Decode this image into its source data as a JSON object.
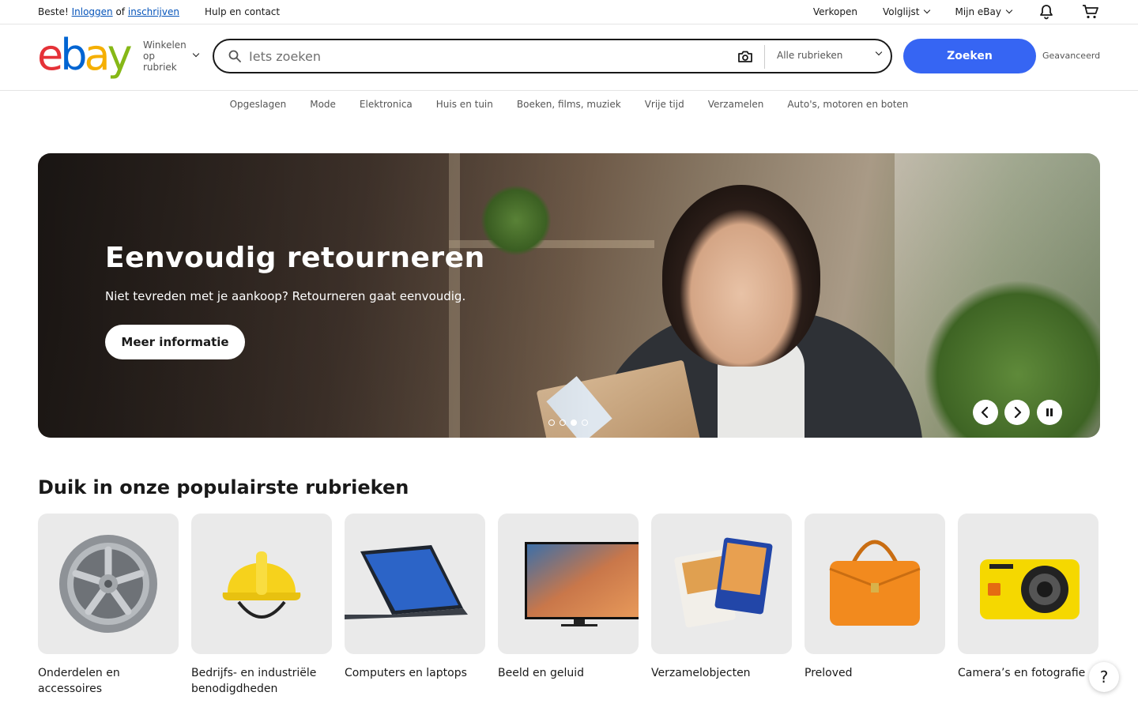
{
  "topbar": {
    "greeting": "Beste!",
    "login": "Inloggen",
    "or": "of",
    "register": "inschrijven",
    "help": "Hulp en contact",
    "sell": "Verkopen",
    "watchlist": "Volglijst",
    "my_ebay": "Mijn eBay"
  },
  "header": {
    "logo_letters": [
      "e",
      "b",
      "a",
      "y"
    ],
    "shop_by_category": "Winkelen op rubriek",
    "search_placeholder": "Iets zoeken",
    "category_select": "Alle rubrieken",
    "search_button": "Zoeken",
    "advanced": "Geavanceerd"
  },
  "catnav": [
    "Opgeslagen",
    "Mode",
    "Elektronica",
    "Huis en tuin",
    "Boeken, films, muziek",
    "Vrije tijd",
    "Verzamelen",
    "Auto's, motoren en boten"
  ],
  "hero": {
    "title": "Eenvoudig retourneren",
    "subtitle": "Niet tevreden met je aankoop? Retourneren gaat eenvoudig.",
    "cta": "Meer informatie",
    "slide_count": 4,
    "active_slide": 3
  },
  "categories": {
    "title": "Duik in onze populairste rubrieken",
    "items": [
      {
        "label": "Onderdelen en accessoires",
        "icon": "wheel-rim-icon"
      },
      {
        "label": "Bedrijfs- en industriële benodigdheden",
        "icon": "hard-hat-icon"
      },
      {
        "label": "Computers en laptops",
        "icon": "laptop-icon"
      },
      {
        "label": "Beeld en geluid",
        "icon": "television-icon"
      },
      {
        "label": "Verzamelobjecten",
        "icon": "trading-cards-icon"
      },
      {
        "label": "Preloved",
        "icon": "handbag-icon"
      },
      {
        "label": "Camera’s en fotografie",
        "icon": "camera-icon"
      }
    ]
  },
  "help_fab": "?",
  "colors": {
    "primary": "#3665f3",
    "link": "#0654ba",
    "logo_e": "#e53238",
    "logo_b": "#0064d2",
    "logo_a": "#f5af02",
    "logo_y": "#86b817"
  }
}
